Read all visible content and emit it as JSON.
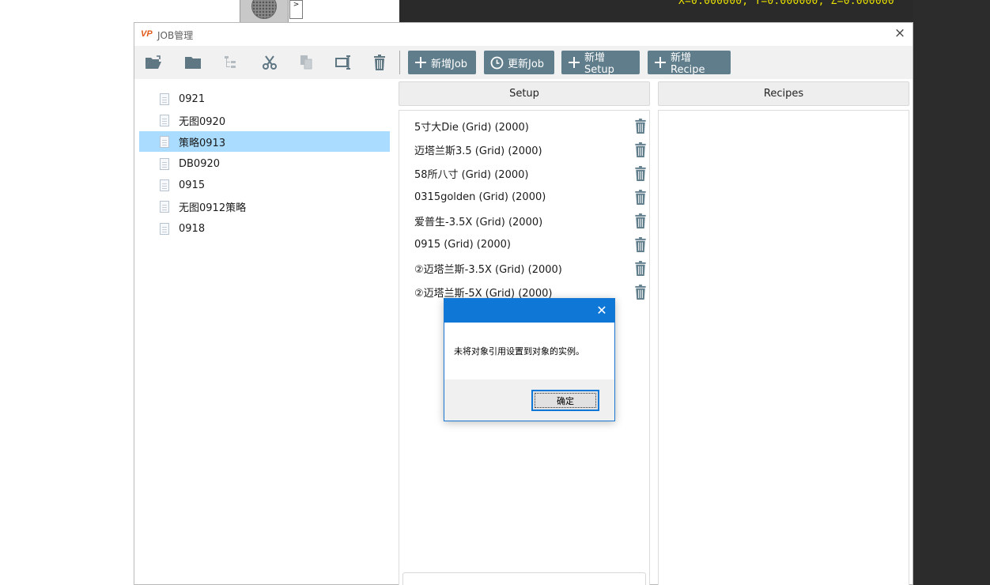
{
  "background": {
    "coord_readout": "X=0.000000, Y=0.000000, Z=0.000000",
    "mini_button": ">"
  },
  "window": {
    "logo": "VP",
    "title": "JOB管理",
    "close": "×"
  },
  "toolbar": {
    "icons": [
      "folder-open-icon",
      "folder-icon",
      "tree-structure-icon",
      "scissors-icon",
      "copy-icon",
      "rename-icon",
      "trash-icon"
    ],
    "buttons": [
      {
        "label": "新增Job",
        "icon": "plus"
      },
      {
        "label": "更新Job",
        "icon": "clock"
      },
      {
        "label": "新增Setup",
        "icon": "plus"
      },
      {
        "label": "新增Recipe",
        "icon": "plus"
      }
    ]
  },
  "tree": {
    "items": [
      "0921",
      "无图0920",
      "策略0913",
      "DB0920",
      "0915",
      "无图0912策略",
      "0918"
    ],
    "selected": "策略0913"
  },
  "setup": {
    "header": "Setup",
    "items": [
      "5寸大Die (Grid) (2000)",
      "迈塔兰斯3.5 (Grid) (2000)",
      "58所八寸 (Grid) (2000)",
      "0315golden (Grid) (2000)",
      "爱普生-3.5X (Grid) (2000)",
      "0915 (Grid) (2000)",
      "②迈塔兰斯-3.5X (Grid) (2000)",
      "②迈塔兰斯-5X (Grid) (2000)"
    ]
  },
  "recipes": {
    "header": "Recipes"
  },
  "dialog": {
    "close": "✕",
    "message": "未将对象引用设置到对象的实例。",
    "ok_label": "确定"
  },
  "colors": {
    "button_bg": "#607d8b",
    "selection": "#a9dcff",
    "dialog_title": "#0f78d7",
    "coord_text": "#e8e000"
  }
}
